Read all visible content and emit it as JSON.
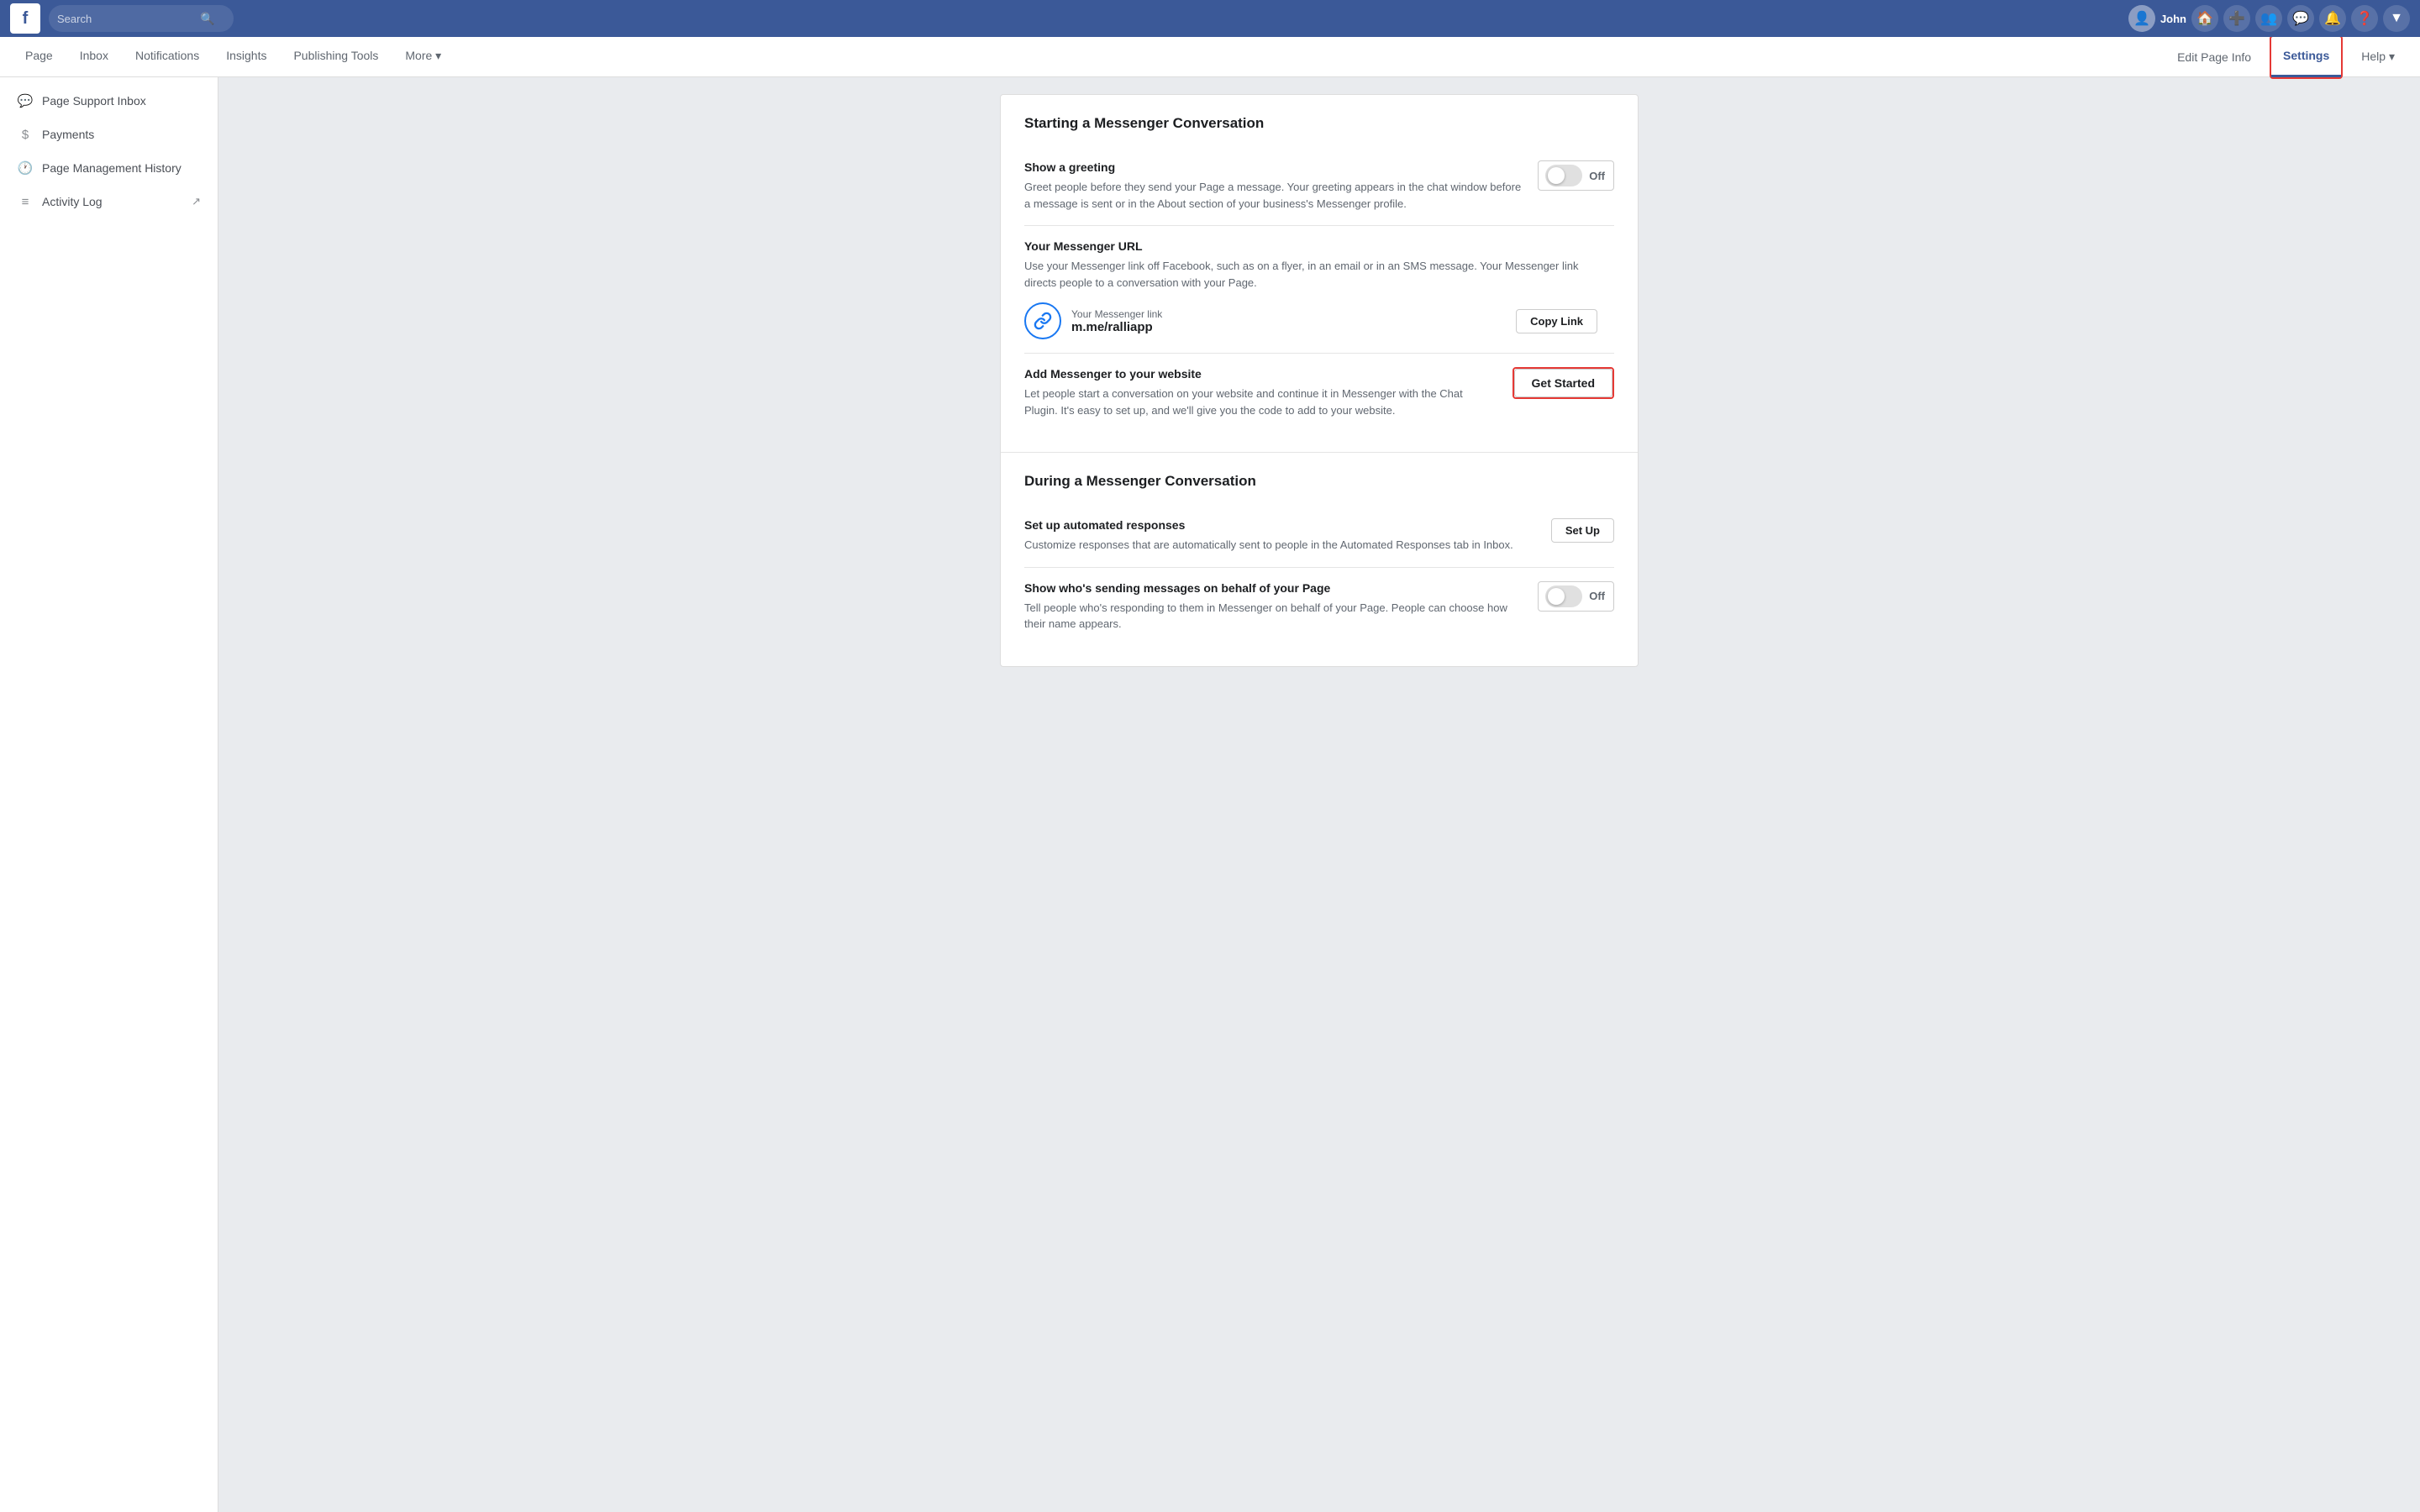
{
  "topnav": {
    "logo": "f",
    "search_placeholder": "Search",
    "user_name": "John",
    "nav_links": [
      "Home",
      "Create"
    ],
    "icons": [
      "people",
      "messenger",
      "notifications",
      "help",
      "dropdown"
    ]
  },
  "secondarynav": {
    "left_items": [
      {
        "label": "Page",
        "active": false
      },
      {
        "label": "Inbox",
        "active": false
      },
      {
        "label": "Notifications",
        "active": false
      },
      {
        "label": "Insights",
        "active": false
      },
      {
        "label": "Publishing Tools",
        "active": false
      },
      {
        "label": "More ▾",
        "active": false
      }
    ],
    "right_items": [
      {
        "label": "Edit Page Info",
        "active": false
      },
      {
        "label": "Settings",
        "active": true
      },
      {
        "label": "Help ▾",
        "active": false
      }
    ]
  },
  "sidebar": {
    "items": [
      {
        "label": "Page Support Inbox",
        "icon": "💬"
      },
      {
        "label": "Payments",
        "icon": "$"
      },
      {
        "label": "Page Management History",
        "icon": "🕐"
      },
      {
        "label": "Activity Log",
        "icon": "≡",
        "external": true
      }
    ]
  },
  "main": {
    "sections": [
      {
        "id": "starting",
        "header": "Starting a Messenger Conversation",
        "settings": [
          {
            "id": "show-greeting",
            "title": "Show a greeting",
            "desc": "Greet people before they send your Page a message. Your greeting appears in the chat window before a message is sent or in the About section of your business's Messenger profile.",
            "action_type": "toggle",
            "action_label": "Off"
          },
          {
            "id": "messenger-url",
            "title": "Your Messenger URL",
            "desc": "Use your Messenger link off Facebook, such as on a flyer, in an email or in an SMS message. Your Messenger link directs people to a conversation with your Page.",
            "action_type": "messenger-url",
            "link_label": "Your Messenger link",
            "link_url": "m.me/ralliapp",
            "action_label": "Copy Link"
          },
          {
            "id": "add-messenger-website",
            "title": "Add Messenger to your website",
            "desc": "Let people start a conversation on your website and continue it in Messenger with the Chat Plugin. It's easy to set up, and we'll give you the code to add to your website.",
            "action_type": "get-started",
            "action_label": "Get Started"
          }
        ]
      },
      {
        "id": "during",
        "header": "During a Messenger Conversation",
        "settings": [
          {
            "id": "automated-responses",
            "title": "Set up automated responses",
            "desc": "Customize responses that are automatically sent to people in the Automated Responses tab in Inbox.",
            "action_type": "setup",
            "action_label": "Set Up"
          },
          {
            "id": "show-sender",
            "title": "Show who's sending messages on behalf of your Page",
            "desc": "Tell people who's responding to them in Messenger on behalf of your Page. People can choose how their name appears.",
            "action_type": "toggle",
            "action_label": "Off"
          }
        ]
      }
    ]
  }
}
